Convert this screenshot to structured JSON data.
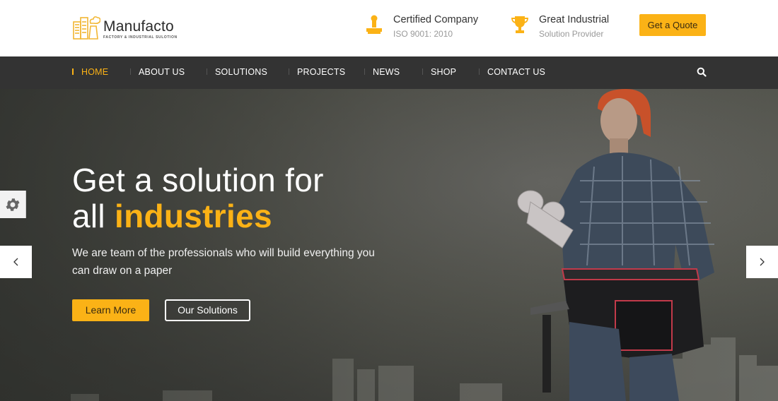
{
  "brand": {
    "name": "Manufacto",
    "tagline": "FACTORY & INDUSTRIAL SULOTION",
    "accent_color": "#fbb216"
  },
  "header": {
    "info": [
      {
        "icon": "stamp-icon",
        "title": "Certified Company",
        "subtitle": "ISO 9001: 2010"
      },
      {
        "icon": "trophy-icon",
        "title": "Great Industrial",
        "subtitle": "Solution Provider"
      }
    ],
    "quote_button": "Get a Quote"
  },
  "nav": {
    "items": [
      {
        "label": "HOME",
        "active": true
      },
      {
        "label": "ABOUT US",
        "active": false
      },
      {
        "label": "SOLUTIONS",
        "active": false
      },
      {
        "label": "PROJECTS",
        "active": false
      },
      {
        "label": "NEWS",
        "active": false
      },
      {
        "label": "SHOP",
        "active": false
      },
      {
        "label": "CONTACT US",
        "active": false
      }
    ],
    "search_icon": "search-icon"
  },
  "hero": {
    "heading_line1": "Get a solution for",
    "heading_line2_plain": "all ",
    "heading_line2_highlight": "industries",
    "subtext": "We are team of the professionals who will build everything you can draw on a paper",
    "primary_button": "Learn More",
    "secondary_button": "Our Solutions",
    "image_description": "Female worker in orange hard hat and plaid shirt holding blueprint rolls, tool belt, city skyline"
  },
  "controls": {
    "settings_icon": "gear-icon",
    "prev_icon": "chevron-left-icon",
    "next_icon": "chevron-right-icon"
  }
}
